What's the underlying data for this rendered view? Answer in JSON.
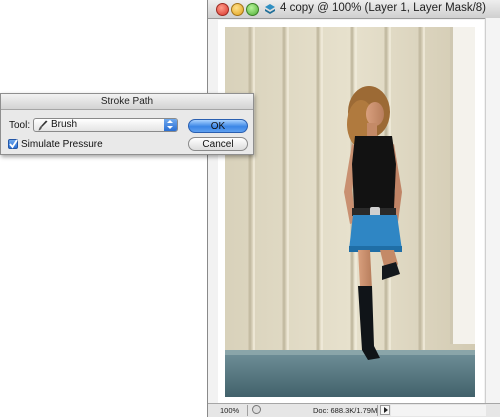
{
  "document": {
    "title": "4 copy @ 100% (Layer 1, Layer Mask/8)",
    "zoom": "100%",
    "doc_size": "Doc: 688.3K/1.79M"
  },
  "dialog": {
    "title": "Stroke Path",
    "tool_label": "Tool:",
    "tool_value": "Brush",
    "simulate_pressure_label": "Simulate Pressure",
    "simulate_pressure_checked": true,
    "ok_label": "OK",
    "cancel_label": "Cancel"
  },
  "colors": {
    "accent": "#3b86e6",
    "wall": "#e3dcc6",
    "shirt": "#111111",
    "skirt": "#2f86c4"
  },
  "icons": [
    "close-icon",
    "minimize-icon",
    "maximize-icon",
    "document-icon",
    "brush-icon",
    "checkmark-icon",
    "info-icon",
    "arrow-right-icon"
  ]
}
